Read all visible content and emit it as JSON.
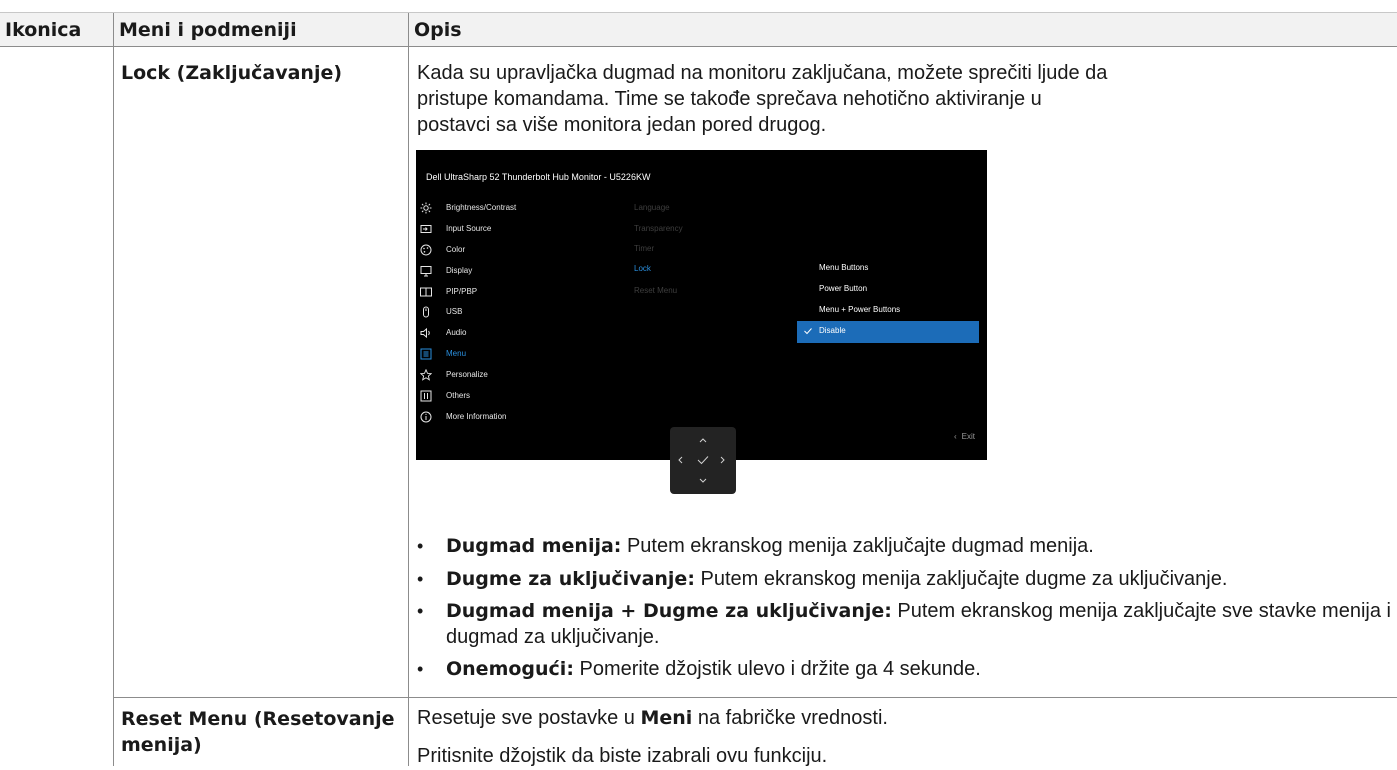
{
  "table": {
    "headers": [
      "Ikonica",
      "Meni i podmeniji",
      "Opis"
    ],
    "rows": [
      {
        "menu": "Lock (Zaključavanje)",
        "intro": "Kada su upravljačka dugmad na monitoru zaključana, možete sprečiti ljude da pristupe komandama. Time se takođe sprečava nehotično aktiviranje u postavci sa više monitora jedan pored drugog.",
        "osd": {
          "title": "Dell UltraSharp 52 Thunderbolt Hub Monitor - U5226KW",
          "menu_items": [
            {
              "label": "Brightness/Contrast",
              "icon": "sun-icon"
            },
            {
              "label": "Input Source",
              "icon": "input-source-icon"
            },
            {
              "label": "Color",
              "icon": "palette-icon"
            },
            {
              "label": "Display",
              "icon": "monitor-icon"
            },
            {
              "label": "PIP/PBP",
              "icon": "pip-pbp-icon"
            },
            {
              "label": "USB",
              "icon": "usb-icon"
            },
            {
              "label": "Audio",
              "icon": "speaker-icon"
            },
            {
              "label": "Menu",
              "icon": "menu-list-icon"
            },
            {
              "label": "Personalize",
              "icon": "star-icon"
            },
            {
              "label": "Others",
              "icon": "others-icon"
            },
            {
              "label": "More Information",
              "icon": "info-icon"
            }
          ],
          "active_menu": "Menu",
          "submenu": [
            "Language",
            "Transparency",
            "Timer",
            "Lock",
            "Reset Menu"
          ],
          "active_submenu": "Lock",
          "options": [
            "Menu Buttons",
            "Power Button",
            "Menu + Power Buttons",
            "Disable"
          ],
          "selected_option": "Disable",
          "exit_label": "Exit",
          "accent_color": "#1c6cb8"
        },
        "bullets": [
          {
            "bold": "Dugmad menija:",
            "text": " Putem ekranskog menija zaključajte dugmad menija."
          },
          {
            "bold": "Dugme za uključivanje:",
            "text": " Putem ekranskog menija zaključajte dugme za uključivanje."
          },
          {
            "bold": "Dugmad menija + Dugme za uključivanje:",
            "text": " Putem ekranskog menija zaključajte sve stavke menija i dugmad za uključivanje."
          },
          {
            "bold": "Onemogući:",
            "text": " Pomerite džojstik ulevo i držite ga 4 sekunde."
          }
        ]
      },
      {
        "menu": "Reset Menu (Resetovanje menija)",
        "desc_line1_prefix": "Resetuje sve postavke u ",
        "desc_line1_bold": "Meni",
        "desc_line1_suffix": " na fabričke vrednosti.",
        "desc_line2": "Pritisnite džojstik da biste izabrali ovu funkciju."
      }
    ]
  }
}
